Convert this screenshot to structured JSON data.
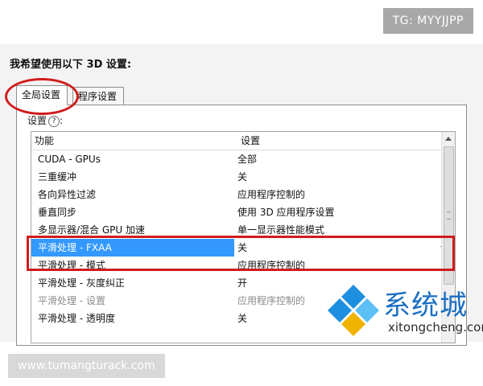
{
  "watermark_top": "TG: MYYJJPP",
  "watermark_bottom": "www.tumangturack.com",
  "logo": {
    "title": "系统城",
    "subtitle": "xitongcheng.com"
  },
  "panel": {
    "heading": "我希望使用以下 3D 设置:",
    "tabs": [
      {
        "label": "全局设置",
        "active": true
      },
      {
        "label": "程序设置",
        "active": false
      }
    ],
    "settings_label": "设置",
    "help_glyph": "?",
    "columns": {
      "feature": "功能",
      "setting": "设置"
    },
    "rows": [
      {
        "feature": "CUDA - GPUs",
        "setting": "全部"
      },
      {
        "feature": "三重缓冲",
        "setting": "关"
      },
      {
        "feature": "各向异性过滤",
        "setting": "应用程序控制的"
      },
      {
        "feature": "垂直同步",
        "setting": "使用 3D 应用程序设置"
      },
      {
        "feature": "多显示器/混合 GPU 加速",
        "setting": "单一显示器性能模式"
      },
      {
        "feature": "平滑处理 - FXAA",
        "setting": "关",
        "selected": true
      },
      {
        "feature": "平滑处理 - 模式",
        "setting": "应用程序控制的"
      },
      {
        "feature": "平滑处理 - 灰度纠正",
        "setting": "开"
      },
      {
        "feature": "平滑处理 - 设置",
        "setting": "应用程序控制的",
        "dim": true
      },
      {
        "feature": "平滑处理 - 透明度",
        "setting": "关"
      }
    ]
  },
  "colors": {
    "highlight": "#3399ff",
    "annotation": "#d01c1c",
    "logo_blue": "#1a6ec2"
  }
}
